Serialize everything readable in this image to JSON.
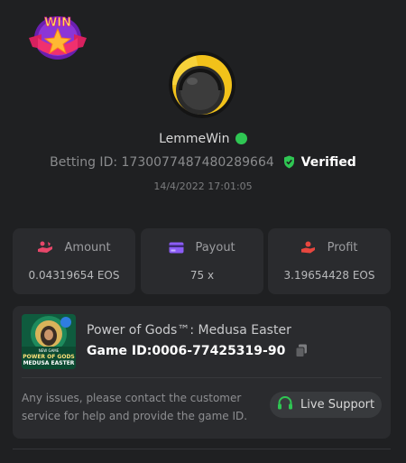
{
  "badge": {
    "text": "WIN"
  },
  "user": {
    "name": "LemmeWin",
    "betting_id_label": "Betting ID:",
    "betting_id": "1730077487480289664",
    "verified_label": "Verified",
    "date": "14/4/2022 17:01:05"
  },
  "stats": [
    {
      "label": "Amount",
      "value": "0.04319654 EOS",
      "icon": "eos-hand-icon",
      "icon_color": "#e8476a"
    },
    {
      "label": "Payout",
      "value": "75 x",
      "icon": "card-icon",
      "icon_color": "#8b5cf6"
    },
    {
      "label": "Profit",
      "value": "3.19654428 EOS",
      "icon": "profit-hand-icon",
      "icon_color": "#e8473f"
    }
  ],
  "game": {
    "title": "Power of Gods™: Medusa Easter",
    "id_label": "Game ID:",
    "id": "0006-77425319-90",
    "thumb_small": "NEW GAME",
    "thumb_line1": "POWER OF GODS",
    "thumb_line2": "MEDUSA EASTER"
  },
  "support": {
    "text": "Any issues, please contact the customer service for help and provide the game ID.",
    "button": "Live Support"
  },
  "colors": {
    "background": "#1f2022",
    "card": "#2a2b2e",
    "online": "#2fc653",
    "verified_shield": "#2fc653",
    "support_icon": "#2fc653"
  }
}
